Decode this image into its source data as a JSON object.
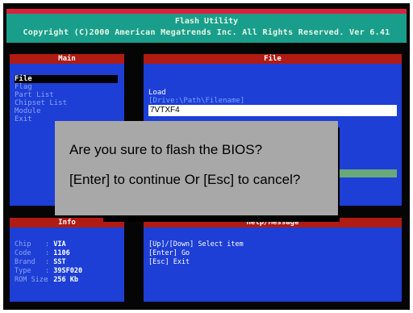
{
  "header": {
    "title": "Flash Utility",
    "copyright": "Copyright (C)2000 American Megatrends Inc. All Rights Reserved. Ver 6.41"
  },
  "main_panel": {
    "title": "Main",
    "items": [
      {
        "label": "File",
        "selected": true
      },
      {
        "label": "Flag",
        "selected": false
      },
      {
        "label": "Part List",
        "selected": false
      },
      {
        "label": "Chipset List",
        "selected": false
      },
      {
        "label": "Module",
        "selected": false
      },
      {
        "label": "Exit",
        "selected": false
      }
    ]
  },
  "file_panel": {
    "title": "File",
    "load_label": "Load",
    "path_hint": "[Drive:\\Path\\Filename]",
    "filename_value": "7VTXF4"
  },
  "info_panel": {
    "title": "Info",
    "rows": [
      {
        "key": "Chip",
        "value": "VIA"
      },
      {
        "key": "Code",
        "value": "1106"
      },
      {
        "key": "Brand",
        "value": "SST"
      },
      {
        "key": "Type",
        "value": "39SF020"
      },
      {
        "key": "ROM Size",
        "value": "256 Kb"
      }
    ]
  },
  "help_panel": {
    "title": "Help/Message",
    "lines": [
      "[Up]/[Down] Select item",
      "[Enter] Go",
      "[Esc] Exit"
    ]
  },
  "dialog": {
    "question": "Are you sure to flash the BIOS?",
    "instruction": "[Enter] to continue Or [Esc] to cancel?"
  },
  "colors": {
    "panel_bg": "#1d3fd6",
    "title_bar": "#b01b13",
    "header_bg": "#1a9e8c",
    "header_accent": "#e0203a",
    "dialog_bg": "#a8a8a8"
  }
}
